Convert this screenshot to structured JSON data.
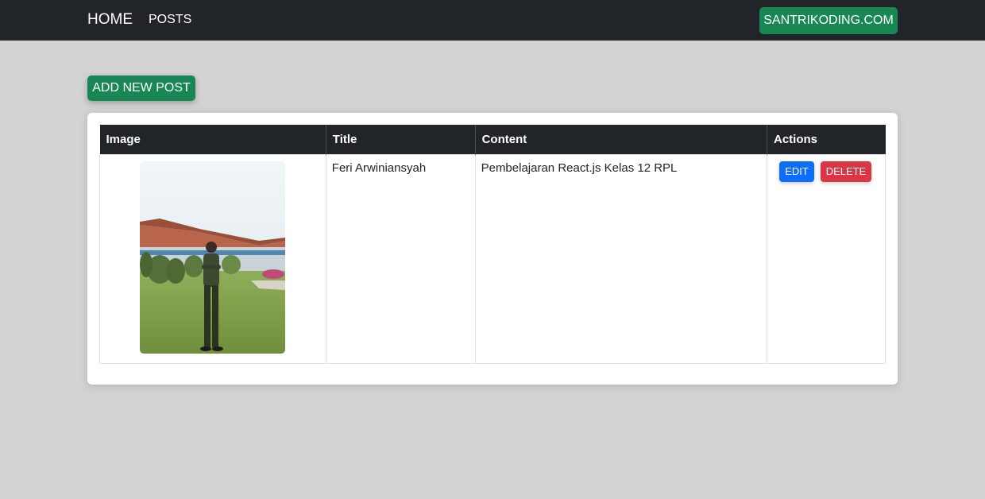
{
  "navbar": {
    "brand": "HOME",
    "links": [
      {
        "label": "POSTS"
      }
    ],
    "right_button": "SANTRIKODING.COM"
  },
  "main": {
    "add_button": "ADD NEW POST",
    "table": {
      "headers": [
        "Image",
        "Title",
        "Content",
        "Actions"
      ],
      "rows": [
        {
          "title": "Feri Arwiniansyah",
          "content": "Pembelajaran React.js Kelas 12 RPL",
          "actions": {
            "edit": "EDIT",
            "delete": "DELETE"
          }
        }
      ]
    }
  },
  "colors": {
    "navbar_bg": "#212529",
    "success": "#198754",
    "primary": "#0d6efd",
    "danger": "#dc3545",
    "page_bg": "#d3d3d3"
  }
}
